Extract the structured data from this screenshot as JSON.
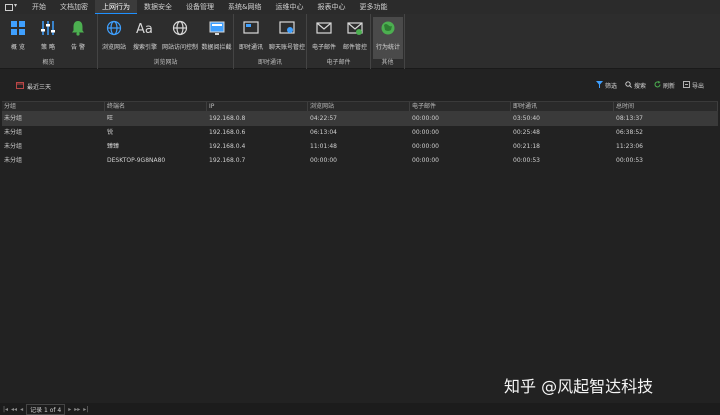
{
  "menu": {
    "tabs": [
      "开始",
      "文档加密",
      "上网行为",
      "数据安全",
      "设备管理",
      "系统&网络",
      "运维中心",
      "报表中心",
      "更多功能"
    ],
    "active_index": 2
  },
  "ribbon": {
    "groups": [
      {
        "label": "概览",
        "buttons": [
          "概 览",
          "策 略",
          "告 警"
        ]
      },
      {
        "label": "浏览网站",
        "buttons": [
          "浏览网站",
          "搜索引擎",
          "网站访问控制",
          "数据阅拦截"
        ]
      },
      {
        "label": "即时通讯",
        "buttons": [
          "即时通讯",
          "聊天账号管控"
        ]
      },
      {
        "label": "电子邮件",
        "buttons": [
          "电子邮件",
          "邮件管控"
        ]
      },
      {
        "label": "其他",
        "buttons": [
          "行为统计"
        ]
      }
    ],
    "selected_button": "行为统计",
    "accent": "#1e90ff",
    "icon_green": "#4caf50"
  },
  "toolbar": {
    "date_filter": "最近三天",
    "actions": [
      "筛选",
      "搜索",
      "刷新",
      "导出"
    ]
  },
  "table": {
    "columns": [
      "分组",
      "终端名",
      "IP",
      "浏览网站",
      "电子邮件",
      "即时通讯",
      "总时间"
    ],
    "rows": [
      [
        "未分组",
        "旺",
        "192.168.0.8",
        "04:22:57",
        "00:00:00",
        "03:50:40",
        "08:13:37"
      ],
      [
        "未分组",
        "锐",
        "192.168.0.6",
        "06:13:04",
        "00:00:00",
        "00:25:48",
        "06:38:52"
      ],
      [
        "未分组",
        "臻臻",
        "192.168.0.4",
        "11:01:48",
        "00:00:00",
        "00:21:18",
        "11:23:06"
      ],
      [
        "未分组",
        "DESKTOP-9G8NA80",
        "192.168.0.7",
        "00:00:00",
        "00:00:00",
        "00:00:53",
        "00:00:53"
      ]
    ],
    "selected_row": 0
  },
  "status": {
    "record_text": "记录 1 of 4"
  },
  "watermark": "知乎 @风起智达科技"
}
